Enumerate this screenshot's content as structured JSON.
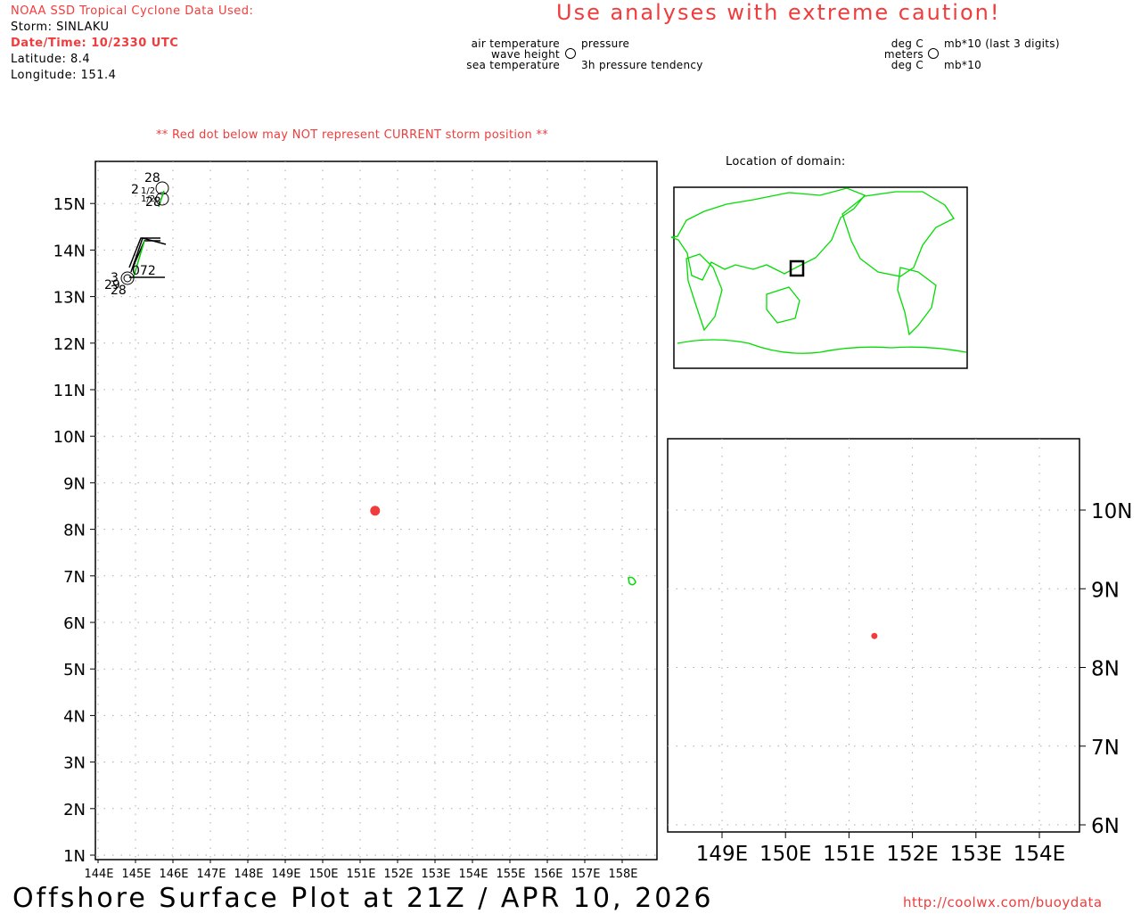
{
  "header": {
    "source": "NOAA SSD Tropical Cyclone Data Used:",
    "storm": "Storm: SINLAKU",
    "datetime": "Date/Time: 10/2330 UTC",
    "latitude": "Latitude: 8.4",
    "longitude": "Longitude: 151.4",
    "caution": "Use analyses with extreme caution!",
    "red_dot_warning": "** Red dot below may NOT represent CURRENT storm position **"
  },
  "legend": {
    "left": {
      "air_temperature": "air temperature",
      "wave_height": "wave height",
      "sea_temperature": "sea temperature",
      "pressure": "pressure",
      "pressure_tendency": "3h pressure tendency"
    },
    "right": {
      "air_unit": "deg C",
      "wave_unit": "meters",
      "sea_unit": "deg C",
      "pressure_unit": "mb*10 (last 3 digits)",
      "tendency_unit": "mb*10"
    }
  },
  "main_map": {
    "lat_labels": [
      "15N",
      "14N",
      "13N",
      "12N",
      "11N",
      "10N",
      "9N",
      "8N",
      "7N",
      "6N",
      "5N",
      "4N",
      "3N",
      "2N",
      "1N"
    ],
    "lon_labels": [
      "144E",
      "145E",
      "146E",
      "147E",
      "148E",
      "149E",
      "150E",
      "151E",
      "152E",
      "153E",
      "154E",
      "155E",
      "156E",
      "157E",
      "158E"
    ],
    "storm_position": {
      "lat": 8.4,
      "lon": 151.4
    },
    "station_labels": [
      "28",
      "2",
      "1/2",
      "1/2",
      "28",
      "3",
      "29",
      "28",
      "072"
    ]
  },
  "locator": {
    "title": "Location of domain:"
  },
  "inset_map": {
    "lat_labels": [
      "10N",
      "9N",
      "8N",
      "7N",
      "6N"
    ],
    "lon_labels": [
      "149E",
      "150E",
      "151E",
      "152E",
      "153E",
      "154E"
    ]
  },
  "footer": {
    "title": "Offshore Surface Plot at 21Z / APR 10, 2026",
    "url": "http://coolwx.com/buoydata"
  },
  "colors": {
    "storm": "#f03c3c",
    "coast": "#00dd00",
    "grid": "#aaaaaa"
  }
}
